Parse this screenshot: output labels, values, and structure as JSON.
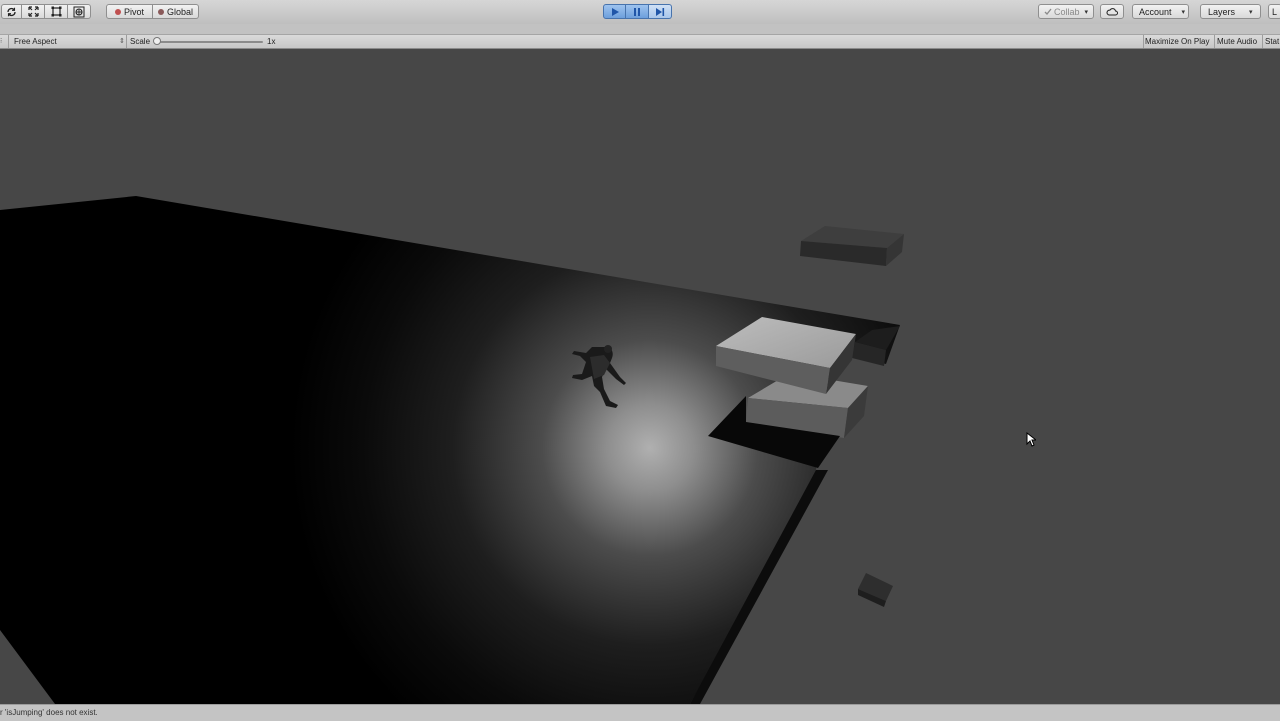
{
  "toolbar": {
    "pivot_label": "Pivot",
    "global_label": "Global",
    "collab_label": "Collab",
    "account_label": "Account",
    "layers_label": "Layers",
    "layout_label": "L"
  },
  "game_toolbar": {
    "display_label": "Free Aspect",
    "scale_label": "Scale",
    "scale_value": "1x",
    "maximize_label": "Maximize On Play",
    "mute_label": "Mute Audio",
    "stats_label": "Stat"
  },
  "status": {
    "message": "r 'isJumping' does not exist."
  },
  "colors": {
    "editor_bg": "#474747",
    "toolbar_bg": "#c8c8c8",
    "play_active": "#6d9fdc"
  },
  "icons": {
    "hand_tool": "refresh-icon",
    "move_tool": "move-icon",
    "rect_tool": "rect-tool-icon",
    "transform_tool": "transform-icon",
    "play": "play-icon",
    "pause": "pause-icon",
    "step": "step-icon",
    "cloud": "cloud-icon",
    "cursor": "mouse-cursor-icon"
  }
}
